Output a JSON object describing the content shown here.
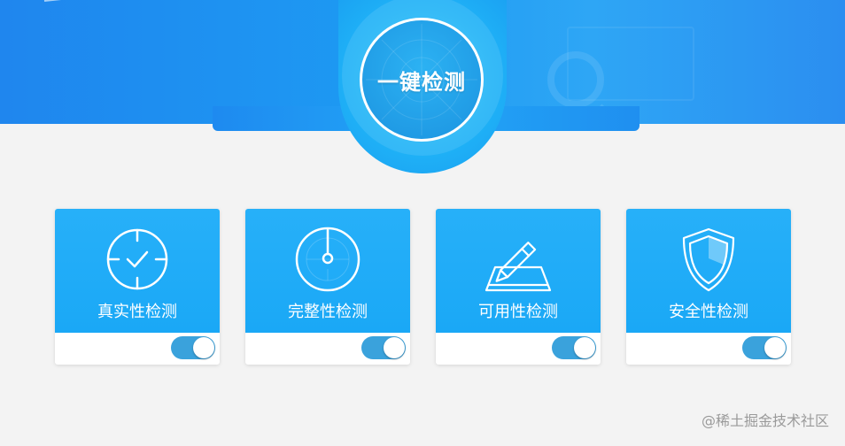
{
  "hero": {
    "label": "一键检测"
  },
  "cards": [
    {
      "label": "真实性检测",
      "icon": "target-check-icon",
      "enabled": true
    },
    {
      "label": "完整性检测",
      "icon": "gauge-icon",
      "enabled": true
    },
    {
      "label": "可用性检测",
      "icon": "pen-tablet-icon",
      "enabled": true
    },
    {
      "label": "安全性检测",
      "icon": "shield-icon",
      "enabled": true
    }
  ],
  "watermark": "@稀土掘金技术社区",
  "colors": {
    "banner": "#1f8ff0",
    "card_top": "#1fabf7",
    "toggle_on": "#3aa2dc",
    "background": "#f3f3f3"
  }
}
